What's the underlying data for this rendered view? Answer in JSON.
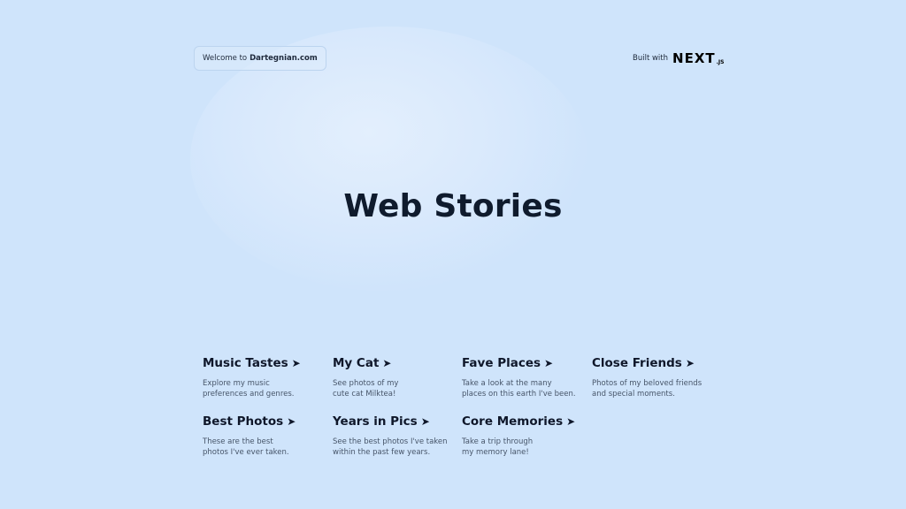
{
  "header": {
    "welcome_prefix": "Welcome to",
    "welcome_site": "Dartegnian.com",
    "built_with": "Built with",
    "framework_logo_main": "NEXT",
    "framework_logo_suffix": ".JS"
  },
  "hero": {
    "title": "Web Stories"
  },
  "stories": [
    {
      "title": "Music Tastes",
      "arrow": "➤",
      "desc": [
        "Explore my music",
        "preferences and genres."
      ]
    },
    {
      "title": "My Cat",
      "arrow": "➤",
      "desc": [
        "See photos of my",
        "cute cat Milktea!"
      ]
    },
    {
      "title": "Fave Places",
      "arrow": "➤",
      "desc": [
        "Take a look at the many",
        "places on this earth I've been."
      ]
    },
    {
      "title": "Close Friends",
      "arrow": "➤",
      "desc": [
        "Photos of my beloved friends",
        "and special moments."
      ]
    },
    {
      "title": "Best Photos",
      "arrow": "➤",
      "desc": [
        "These are the best",
        "photos I've ever taken."
      ]
    },
    {
      "title": "Years in Pics",
      "arrow": "➤",
      "desc": [
        "See the best photos I've taken",
        "within the past few years."
      ]
    },
    {
      "title": "Core Memories",
      "arrow": "➤",
      "desc": [
        "Take a trip through",
        "my memory lane!"
      ]
    }
  ],
  "colors": {
    "background": "#cfe4fb",
    "title": "#0f1b2d",
    "description": "#475569"
  }
}
